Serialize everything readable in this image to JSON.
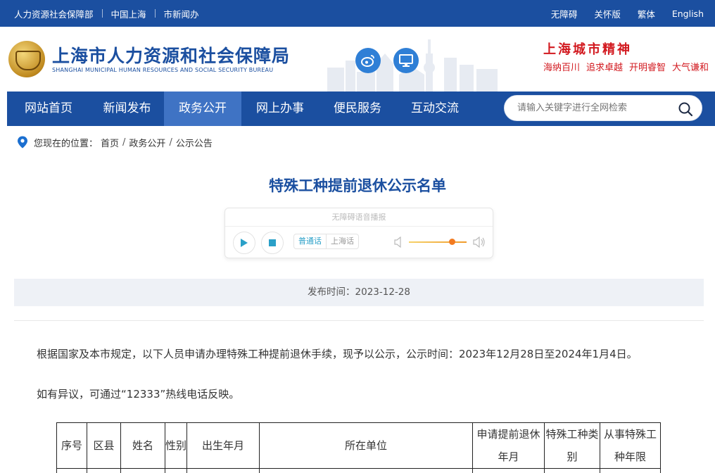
{
  "topbar": {
    "links": [
      "人力资源社会保障部",
      "中国上海",
      "市新闻办"
    ],
    "right": [
      "无障碍",
      "关怀版",
      "繁体",
      "English"
    ]
  },
  "header": {
    "brand_cn": "上海市人力资源和社会保障局",
    "brand_en": "SHANGHAI MUNICIPAL HUMAN RESOURCES AND SOCIAL SECURITY BUREAU",
    "spirit_title": "上海城市精神",
    "spirit_words": [
      "海纳百川",
      "追求卓越",
      "开明睿智",
      "大气谦和"
    ]
  },
  "nav": {
    "items": [
      "网站首页",
      "新闻发布",
      "政务公开",
      "网上办事",
      "便民服务",
      "互动交流"
    ],
    "active_index": 2,
    "search_placeholder": "请输入关键字进行全网检索"
  },
  "breadcrumb": {
    "label": "您现在的位置：",
    "items": [
      "首页",
      "政务公开",
      "公示公告"
    ]
  },
  "article": {
    "title": "特殊工种提前退休公示名单",
    "date_text": "发布时间：2023-12-28",
    "para1": "根据国家及本市规定，以下人员申请办理特殊工种提前退休手续，现予以公示，公示时间：2023年12月28日至2024年1月4日。",
    "para2": "如有异议，可通过“12333”热线电话反映。"
  },
  "player": {
    "caption": "无障碍语音播报",
    "lang_on": "普通话",
    "lang_off": "上海话",
    "volume_level": 0.75
  },
  "table": {
    "headers": [
      "序号",
      "区县",
      "姓名",
      "性别",
      "出生年月",
      "所在单位",
      "申请提前退休年月",
      "特殊工种类别",
      "从事特殊工种年限"
    ]
  },
  "colors": {
    "brand_blue": "#1b4fa0",
    "nav_active": "#3f73c4",
    "spirit_red": "#d2191f",
    "player_accent": "#2aa0c8",
    "volume_knob": "#f27a20"
  }
}
